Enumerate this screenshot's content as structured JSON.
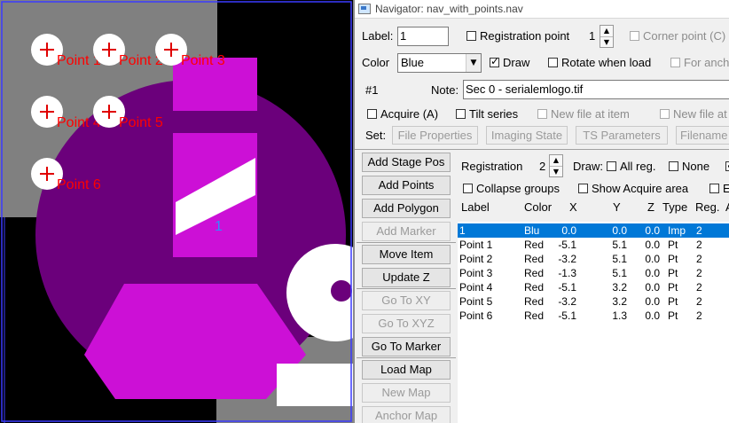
{
  "image_view": {
    "registration_label": "1",
    "points": [
      {
        "label": "Point 1"
      },
      {
        "label": "Point 2"
      },
      {
        "label": "Point 3"
      },
      {
        "label": "Point 4"
      },
      {
        "label": "Point 5"
      },
      {
        "label": "Point 6"
      }
    ],
    "colors": {
      "purple": "#6b007b",
      "magenta": "#cc10d6",
      "gray": "#808080",
      "marker_red": "#ff0000",
      "label_blue": "#2f8cff"
    }
  },
  "window": {
    "title": "Navigator:  nav_with_points.nav"
  },
  "form": {
    "label_caption": "Label:",
    "label_value": "1",
    "registration_point_label": "Registration point",
    "registration_point_value": "1",
    "corner_point_label": "Corner point (C)",
    "color_caption": "Color",
    "color_value": "Blue",
    "draw_label": "Draw",
    "rotate_label": "Rotate when load",
    "for_anchor_label": "For anch",
    "item_number": "#1",
    "note_caption": "Note:",
    "note_value": "Sec 0 - serialemlogo.tif",
    "acquire_label": "Acquire (A)",
    "tilt_series_label": "Tilt series",
    "new_file_label": "New file at item",
    "new_file_label2": "New file at",
    "set_caption": "Set:",
    "set_buttons": [
      "File Properties",
      "Imaging State",
      "TS Parameters",
      "Filename"
    ]
  },
  "buttons": {
    "add_stage_pos": "Add Stage Pos",
    "add_points": "Add Points",
    "add_polygon": "Add Polygon",
    "add_marker": "Add Marker",
    "move_item": "Move Item",
    "update_z": "Update Z",
    "go_to_xy": "Go To XY",
    "go_to_xyz": "Go To XYZ",
    "go_to_marker": "Go To Marker",
    "load_map": "Load Map",
    "new_map": "New Map",
    "anchor_map": "Anchor Map"
  },
  "options": {
    "registration_caption": "Registration",
    "registration_value": "2",
    "draw_caption": "Draw:",
    "all_reg_label": "All reg.",
    "none_label": "None",
    "collapse_groups_label": "Collapse groups",
    "show_acquire_area_label": "Show Acquire area",
    "e_label": "E"
  },
  "table": {
    "headers": [
      "Label",
      "Color",
      "X",
      "Y",
      "Z",
      "Type",
      "Reg.",
      "A"
    ],
    "rows": [
      {
        "label": "1",
        "color": "Blu",
        "x": "0.0",
        "y": "0.0",
        "z": "0.0",
        "type": "Imp",
        "reg": "2"
      },
      {
        "label": "Point 1",
        "color": "Red",
        "x": "-5.1",
        "y": "5.1",
        "z": "0.0",
        "type": "Pt",
        "reg": "2"
      },
      {
        "label": "Point 2",
        "color": "Red",
        "x": "-3.2",
        "y": "5.1",
        "z": "0.0",
        "type": "Pt",
        "reg": "2"
      },
      {
        "label": "Point 3",
        "color": "Red",
        "x": "-1.3",
        "y": "5.1",
        "z": "0.0",
        "type": "Pt",
        "reg": "2"
      },
      {
        "label": "Point 4",
        "color": "Red",
        "x": "-5.1",
        "y": "3.2",
        "z": "0.0",
        "type": "Pt",
        "reg": "2"
      },
      {
        "label": "Point 5",
        "color": "Red",
        "x": "-3.2",
        "y": "3.2",
        "z": "0.0",
        "type": "Pt",
        "reg": "2"
      },
      {
        "label": "Point 6",
        "color": "Red",
        "x": "-5.1",
        "y": "1.3",
        "z": "0.0",
        "type": "Pt",
        "reg": "2"
      }
    ]
  }
}
